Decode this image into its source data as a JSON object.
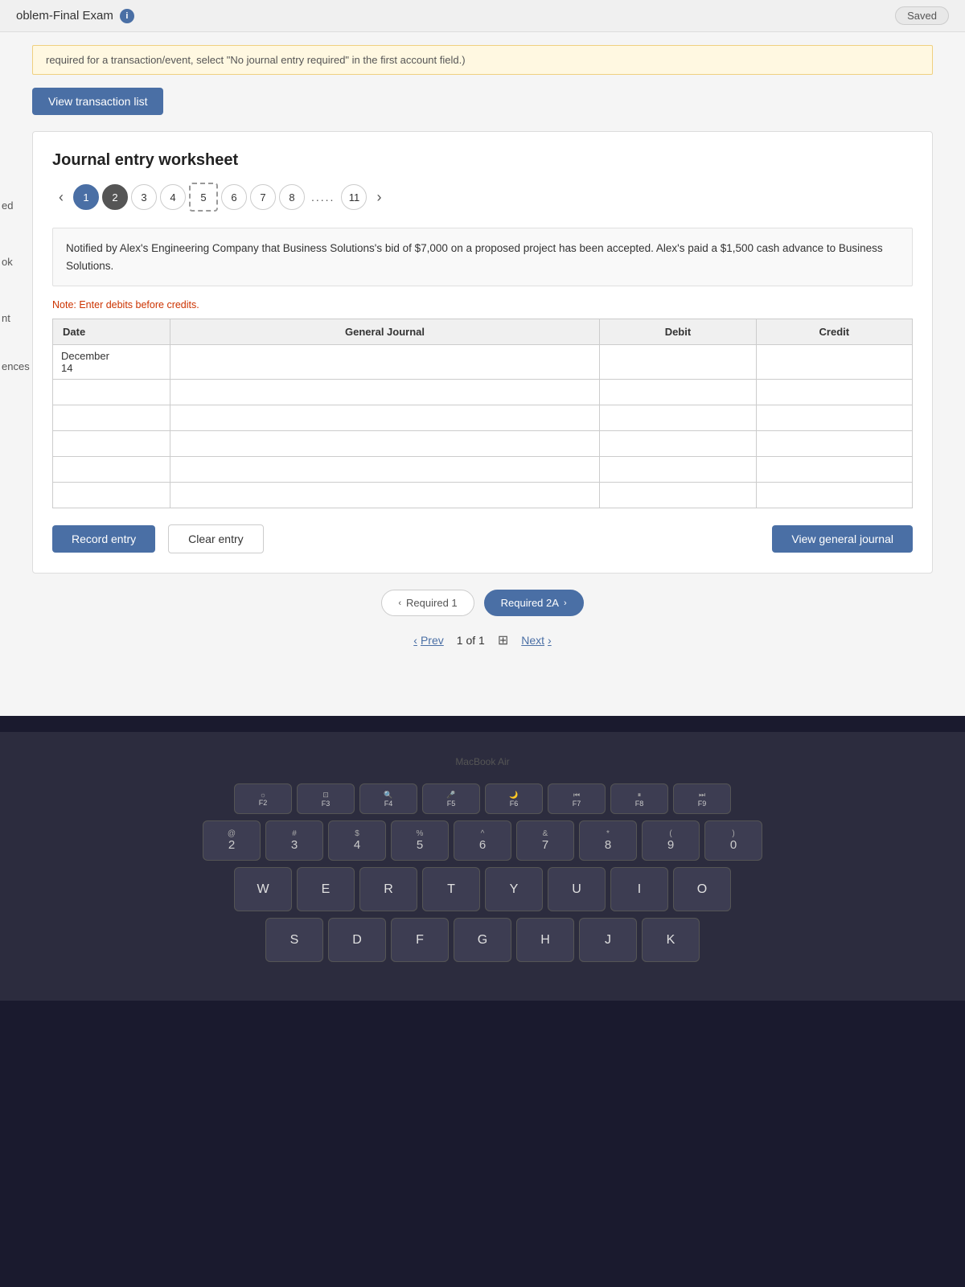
{
  "topBar": {
    "title": "oblem-Final Exam",
    "info_icon": "info-icon",
    "saved_label": "Saved"
  },
  "instruction": {
    "text": "required for a transaction/event, select \"No journal entry required\" in the first account field.)"
  },
  "buttons": {
    "view_transaction": "View transaction list",
    "record_entry": "Record entry",
    "clear_entry": "Clear entry",
    "view_journal": "View general journal"
  },
  "worksheet": {
    "title": "Journal entry worksheet",
    "pages": [
      "1",
      "2",
      "3",
      "4",
      "5",
      "6",
      "7",
      "8",
      "11"
    ],
    "selected_page": "5",
    "active_page": "2",
    "dots_label": ".....",
    "description": "Notified by Alex's Engineering Company that Business Solutions's bid of $7,000 on a proposed project has been accepted. Alex's paid a $1,500 cash advance to Business Solutions.",
    "note": "Note: Enter debits before credits."
  },
  "table": {
    "headers": {
      "date": "Date",
      "journal": "General Journal",
      "debit": "Debit",
      "credit": "Credit"
    },
    "rows": [
      {
        "date": "December\n14",
        "journal": "",
        "debit": "",
        "credit": ""
      },
      {
        "date": "",
        "journal": "",
        "debit": "",
        "credit": ""
      },
      {
        "date": "",
        "journal": "",
        "debit": "",
        "credit": ""
      },
      {
        "date": "",
        "journal": "",
        "debit": "",
        "credit": ""
      },
      {
        "date": "",
        "journal": "",
        "debit": "",
        "credit": ""
      },
      {
        "date": "",
        "journal": "",
        "debit": "",
        "credit": ""
      }
    ]
  },
  "nav": {
    "required1": "Required 1",
    "required2a": "Required 2A",
    "chevron_left": "‹",
    "chevron_right": "›"
  },
  "pagination": {
    "prev": "Prev",
    "next": "Next",
    "page": "1",
    "total": "1"
  },
  "sidebar": {
    "items": [
      "ed",
      "ok",
      "nt",
      "ences"
    ]
  },
  "keyboard": {
    "fn_row": [
      "F2",
      "F3",
      "F4",
      "F5",
      "F6",
      "F7",
      "F8",
      "F9"
    ],
    "number_row": [
      "@\n2",
      "#\n3",
      "$\n4",
      "%\n5",
      "^\n6",
      "&\n7",
      "*\n8",
      "(\n9",
      ")\n0"
    ],
    "qwer_row": [
      "W",
      "E",
      "R",
      "T",
      "Y",
      "U",
      "I",
      "O"
    ],
    "asdf_row": [
      "S",
      "D",
      "F",
      "G",
      "H",
      "J",
      "K"
    ]
  }
}
